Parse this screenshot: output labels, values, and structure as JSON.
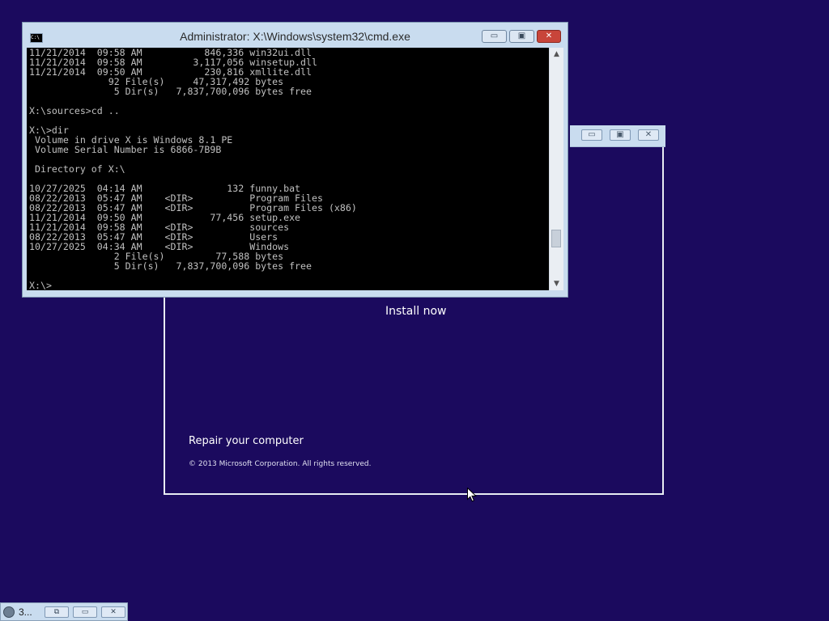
{
  "setup": {
    "install_now": "Install now",
    "repair": "Repair your computer",
    "copyright": "© 2013 Microsoft Corporation. All rights reserved.",
    "controls": {
      "minimize": "▭",
      "restore": "▣",
      "close": "✕"
    }
  },
  "cmd": {
    "title": "Administrator: X:\\Windows\\system32\\cmd.exe",
    "icon_text": "C:\\",
    "controls": {
      "minimize": "▭",
      "restore": "▣",
      "close": "✕"
    },
    "lines": [
      "11/21/2014  09:58 AM           846,336 win32ui.dll",
      "11/21/2014  09:58 AM         3,117,056 winsetup.dll",
      "11/21/2014  09:50 AM           230,816 xmllite.dll",
      "              92 File(s)     47,317,492 bytes",
      "               5 Dir(s)   7,837,700,096 bytes free",
      "",
      "X:\\sources>cd ..",
      "",
      "X:\\>dir",
      " Volume in drive X is Windows 8.1 PE",
      " Volume Serial Number is 6866-7B9B",
      "",
      " Directory of X:\\",
      "",
      "10/27/2025  04:14 AM               132 funny.bat",
      "08/22/2013  05:47 AM    <DIR>          Program Files",
      "08/22/2013  05:47 AM    <DIR>          Program Files (x86)",
      "11/21/2014  09:50 AM            77,456 setup.exe",
      "11/21/2014  09:58 AM    <DIR>          sources",
      "08/22/2013  05:47 AM    <DIR>          Users",
      "10/27/2025  04:34 AM    <DIR>          Windows",
      "               2 File(s)         77,588 bytes",
      "               5 Dir(s)   7,837,700,096 bytes free",
      "",
      "X:\\>"
    ]
  },
  "minimized": {
    "title": "3...",
    "controls": {
      "restore": "⧉",
      "maximize": "▭",
      "close": "✕"
    }
  }
}
